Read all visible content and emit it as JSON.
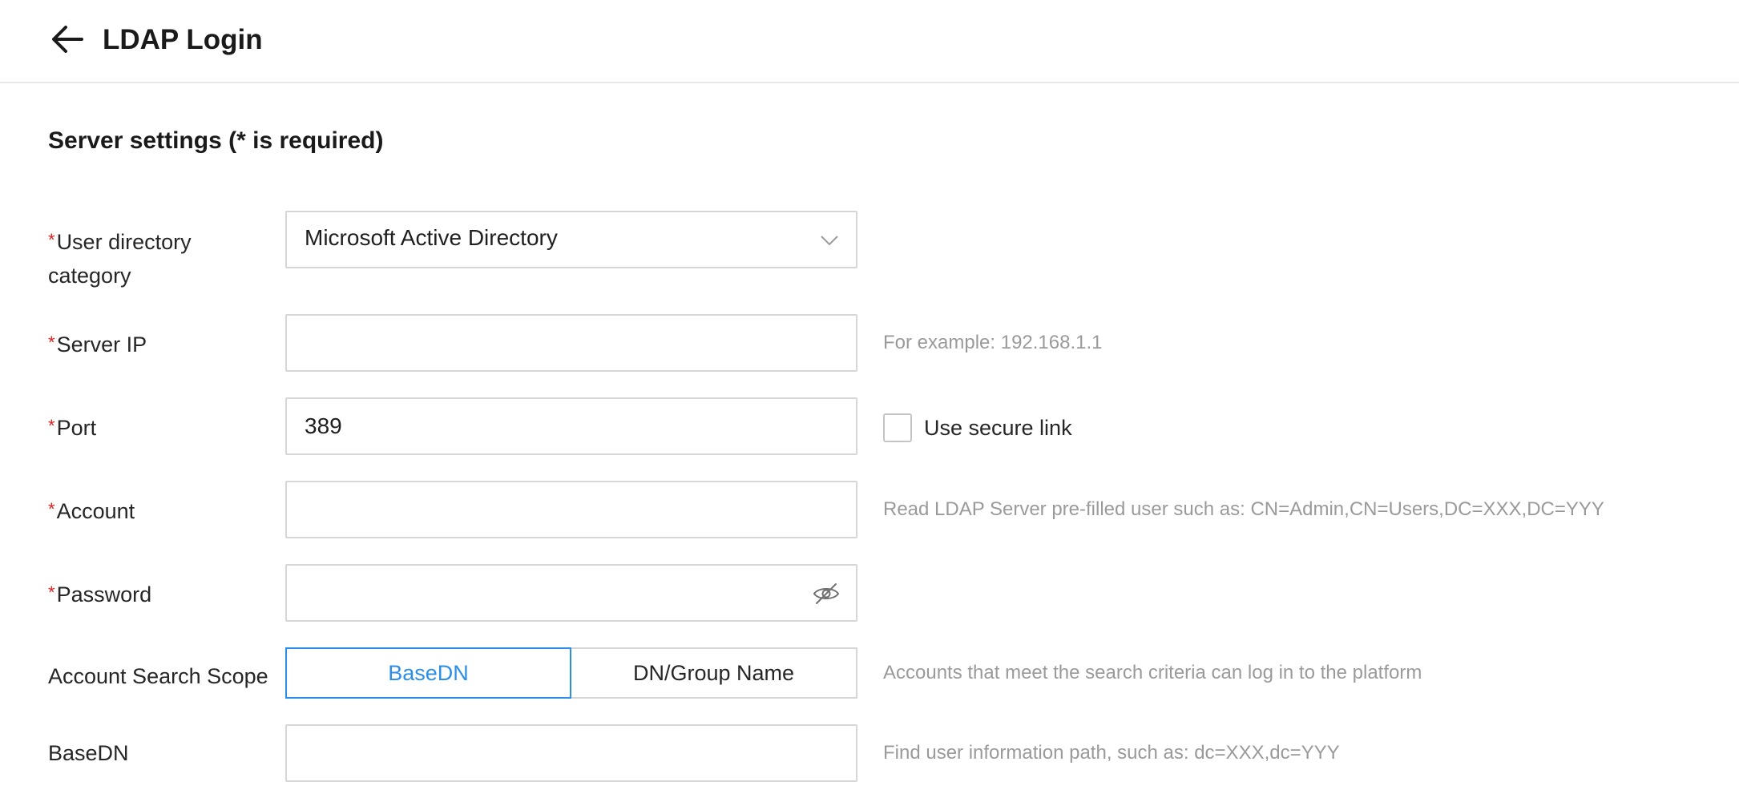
{
  "header": {
    "title": "LDAP Login",
    "back_icon": "arrow-left-icon"
  },
  "section": {
    "title": "Server settings (* is required)"
  },
  "form": {
    "required_mark": "*",
    "user_directory_category": {
      "label": "User directory category",
      "selected": "Microsoft Active Directory",
      "icon": "chevron-down-icon"
    },
    "server_ip": {
      "label": "Server IP",
      "value": "",
      "hint": "For example: 192.168.1.1"
    },
    "port": {
      "label": "Port",
      "value": "389",
      "secure_link_label": "Use secure link",
      "secure_link_checked": false
    },
    "account": {
      "label": "Account",
      "value": "",
      "hint": "Read LDAP Server pre-filled user such as: CN=Admin,CN=Users,DC=XXX,DC=YYY"
    },
    "password": {
      "label": "Password",
      "value": "",
      "icon": "eye-slash-icon"
    },
    "account_search_scope": {
      "label": "Account Search Scope",
      "options": [
        "BaseDN",
        "DN/Group Name"
      ],
      "selected": "BaseDN",
      "hint": "Accounts that meet the search criteria can log in to the platform"
    },
    "basedn": {
      "label": "BaseDN",
      "value": "",
      "hint": "Find user information path, such as: dc=XXX,dc=YYY"
    }
  },
  "colors": {
    "accent": "#2b8ee8",
    "required": "#e02020",
    "hint": "#9a9a9a",
    "border": "#d6d6d6"
  }
}
